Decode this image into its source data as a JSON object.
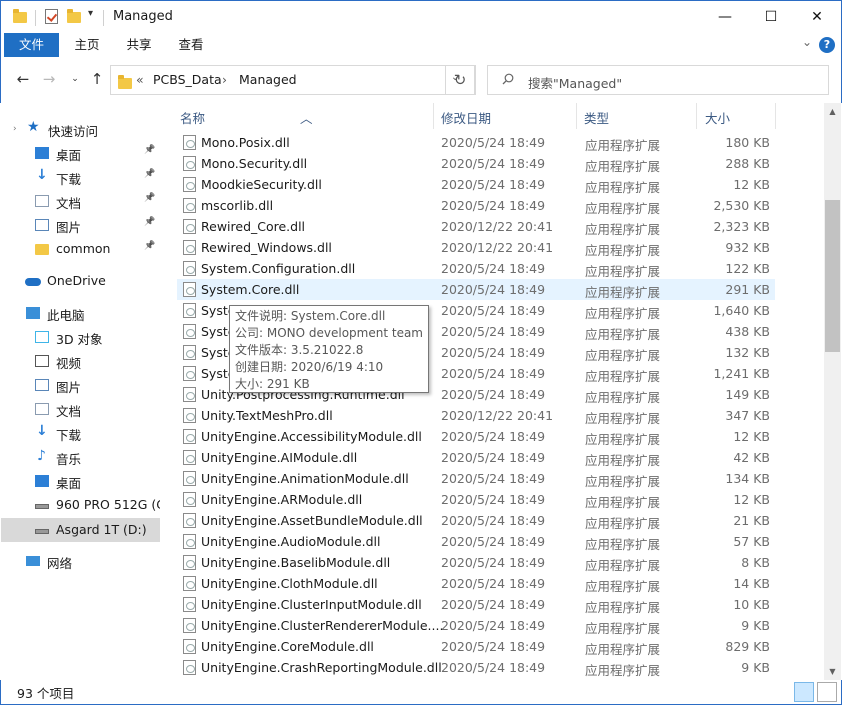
{
  "window": {
    "title": "Managed",
    "minimize": "—",
    "maximize": "☐",
    "close": "✕"
  },
  "ribbon": {
    "tabs": [
      "文件",
      "主页",
      "共享",
      "查看"
    ],
    "help": "?",
    "collapse": "⌄"
  },
  "address": {
    "breadcrumb_sep": "«",
    "crumbs": [
      "PCBS_Data",
      "Managed"
    ],
    "crumb_arrow": "›",
    "search_placeholder": "搜索\"Managed\""
  },
  "nav": {
    "quick_access": "快速访问",
    "items": [
      {
        "label": "桌面",
        "icon": "desktop-icon",
        "pinned": true
      },
      {
        "label": "下载",
        "icon": "download-icon",
        "pinned": true
      },
      {
        "label": "文档",
        "icon": "document-icon",
        "pinned": true
      },
      {
        "label": "图片",
        "icon": "picture-icon",
        "pinned": true
      },
      {
        "label": "common",
        "icon": "folder-icon",
        "pinned": true
      },
      {
        "label": "OneDrive",
        "icon": "cloud-icon"
      },
      {
        "label": "此电脑",
        "icon": "computer-icon"
      },
      {
        "label": "3D 对象",
        "icon": "3d-objects-icon"
      },
      {
        "label": "视频",
        "icon": "video-icon"
      },
      {
        "label": "图片",
        "icon": "picture-icon"
      },
      {
        "label": "文档",
        "icon": "document-icon"
      },
      {
        "label": "下载",
        "icon": "download-icon"
      },
      {
        "label": "音乐",
        "icon": "music-icon"
      },
      {
        "label": "桌面",
        "icon": "desktop-icon"
      },
      {
        "label": "960 PRO 512G (C:",
        "icon": "drive-c-icon"
      },
      {
        "label": "Asgard 1T (D:)",
        "icon": "drive-d-icon",
        "selected": true
      },
      {
        "label": "网络",
        "icon": "network-icon"
      }
    ]
  },
  "columns": {
    "name": "名称",
    "date": "修改日期",
    "type": "类型",
    "size": "大小"
  },
  "files": [
    {
      "name": "Mono.Posix.dll",
      "date": "2020/5/24 18:49",
      "type": "应用程序扩展",
      "size": "180 KB"
    },
    {
      "name": "Mono.Security.dll",
      "date": "2020/5/24 18:49",
      "type": "应用程序扩展",
      "size": "288 KB"
    },
    {
      "name": "MoodkieSecurity.dll",
      "date": "2020/5/24 18:49",
      "type": "应用程序扩展",
      "size": "12 KB"
    },
    {
      "name": "mscorlib.dll",
      "date": "2020/5/24 18:49",
      "type": "应用程序扩展",
      "size": "2,530 KB"
    },
    {
      "name": "Rewired_Core.dll",
      "date": "2020/12/22 20:41",
      "type": "应用程序扩展",
      "size": "2,323 KB"
    },
    {
      "name": "Rewired_Windows.dll",
      "date": "2020/12/22 20:41",
      "type": "应用程序扩展",
      "size": "932 KB"
    },
    {
      "name": "System.Configuration.dll",
      "date": "2020/5/24 18:49",
      "type": "应用程序扩展",
      "size": "122 KB"
    },
    {
      "name": "System.Core.dll",
      "date": "2020/5/24 18:49",
      "type": "应用程序扩展",
      "size": "291 KB",
      "hover": true
    },
    {
      "name": "Syste",
      "date": "2020/5/24 18:49",
      "type": "应用程序扩展",
      "size": "1,640 KB"
    },
    {
      "name": "Syste",
      "date": "2020/5/24 18:49",
      "type": "应用程序扩展",
      "size": "438 KB"
    },
    {
      "name": "Syste",
      "date": "2020/5/24 18:49",
      "type": "应用程序扩展",
      "size": "132 KB"
    },
    {
      "name": "Syste",
      "date": "2020/5/24 18:49",
      "type": "应用程序扩展",
      "size": "1,241 KB"
    },
    {
      "name": "Unity.Postprocessing.Runtime.dll",
      "date": "2020/5/24 18:49",
      "type": "应用程序扩展",
      "size": "149 KB"
    },
    {
      "name": "Unity.TextMeshPro.dll",
      "date": "2020/12/22 20:41",
      "type": "应用程序扩展",
      "size": "347 KB"
    },
    {
      "name": "UnityEngine.AccessibilityModule.dll",
      "date": "2020/5/24 18:49",
      "type": "应用程序扩展",
      "size": "12 KB"
    },
    {
      "name": "UnityEngine.AIModule.dll",
      "date": "2020/5/24 18:49",
      "type": "应用程序扩展",
      "size": "42 KB"
    },
    {
      "name": "UnityEngine.AnimationModule.dll",
      "date": "2020/5/24 18:49",
      "type": "应用程序扩展",
      "size": "134 KB"
    },
    {
      "name": "UnityEngine.ARModule.dll",
      "date": "2020/5/24 18:49",
      "type": "应用程序扩展",
      "size": "12 KB"
    },
    {
      "name": "UnityEngine.AssetBundleModule.dll",
      "date": "2020/5/24 18:49",
      "type": "应用程序扩展",
      "size": "21 KB"
    },
    {
      "name": "UnityEngine.AudioModule.dll",
      "date": "2020/5/24 18:49",
      "type": "应用程序扩展",
      "size": "57 KB"
    },
    {
      "name": "UnityEngine.BaselibModule.dll",
      "date": "2020/5/24 18:49",
      "type": "应用程序扩展",
      "size": "8 KB"
    },
    {
      "name": "UnityEngine.ClothModule.dll",
      "date": "2020/5/24 18:49",
      "type": "应用程序扩展",
      "size": "14 KB"
    },
    {
      "name": "UnityEngine.ClusterInputModule.dll",
      "date": "2020/5/24 18:49",
      "type": "应用程序扩展",
      "size": "10 KB"
    },
    {
      "name": "UnityEngine.ClusterRendererModule....",
      "date": "2020/5/24 18:49",
      "type": "应用程序扩展",
      "size": "9 KB"
    },
    {
      "name": "UnityEngine.CoreModule.dll",
      "date": "2020/5/24 18:49",
      "type": "应用程序扩展",
      "size": "829 KB"
    },
    {
      "name": "UnityEngine.CrashReportingModule.dll",
      "date": "2020/5/24 18:49",
      "type": "应用程序扩展",
      "size": "9 KB"
    }
  ],
  "tooltip": {
    "lines": [
      "文件说明: System.Core.dll",
      "公司: MONO development team",
      "文件版本: 3.5.21022.8",
      "创建日期: 2020/6/19 4:10",
      "大小: 291 KB"
    ]
  },
  "status": {
    "item_count": "93 个项目"
  },
  "colors": {
    "accent": "#1f6fc4",
    "hover_row": "#e5f3ff",
    "selected_nav": "#d9d9d9"
  }
}
